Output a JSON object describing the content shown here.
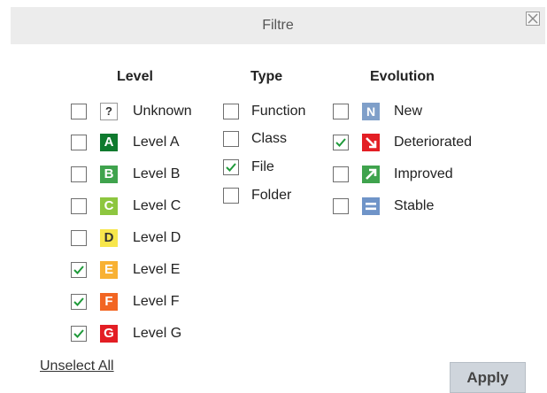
{
  "dialog": {
    "title": "Filtre",
    "close_icon": "close-icon"
  },
  "level": {
    "header": "Level",
    "items": [
      {
        "label": "Unknown",
        "badge": "?",
        "color": "#ffffff",
        "text_color": "#333333",
        "checked": false
      },
      {
        "label": "Level A",
        "badge": "A",
        "color": "#0f7a2e",
        "text_color": "#ffffff",
        "checked": false
      },
      {
        "label": "Level B",
        "badge": "B",
        "color": "#3fa34d",
        "text_color": "#ffffff",
        "checked": false
      },
      {
        "label": "Level C",
        "badge": "C",
        "color": "#8dc63f",
        "text_color": "#ffffff",
        "checked": false
      },
      {
        "label": "Level D",
        "badge": "D",
        "color": "#f7e64b",
        "text_color": "#333333",
        "checked": false
      },
      {
        "label": "Level E",
        "badge": "E",
        "color": "#f8b133",
        "text_color": "#ffffff",
        "checked": true
      },
      {
        "label": "Level F",
        "badge": "F",
        "color": "#f26522",
        "text_color": "#ffffff",
        "checked": true
      },
      {
        "label": "Level G",
        "badge": "G",
        "color": "#e31e24",
        "text_color": "#ffffff",
        "checked": true
      }
    ]
  },
  "type": {
    "header": "Type",
    "items": [
      {
        "label": "Function",
        "checked": false
      },
      {
        "label": "Class",
        "checked": false
      },
      {
        "label": "File",
        "checked": true
      },
      {
        "label": "Folder",
        "checked": false
      }
    ]
  },
  "evolution": {
    "header": "Evolution",
    "items": [
      {
        "label": "New",
        "icon": "new-icon",
        "color": "#7f9fc9",
        "checked": false
      },
      {
        "label": "Deteriorated",
        "icon": "arrow-down-right-icon",
        "color": "#e31e24",
        "checked": true
      },
      {
        "label": "Improved",
        "icon": "arrow-up-right-icon",
        "color": "#3fa34d",
        "checked": false
      },
      {
        "label": "Stable",
        "icon": "stable-icon",
        "color": "#6f94c8",
        "checked": false
      }
    ]
  },
  "footer": {
    "unselect_all": "Unselect All",
    "apply": "Apply"
  },
  "colors": {
    "checkmark": "#1f9a3a",
    "titlebar": "#ececec",
    "apply_bg": "#cfd5dc"
  }
}
